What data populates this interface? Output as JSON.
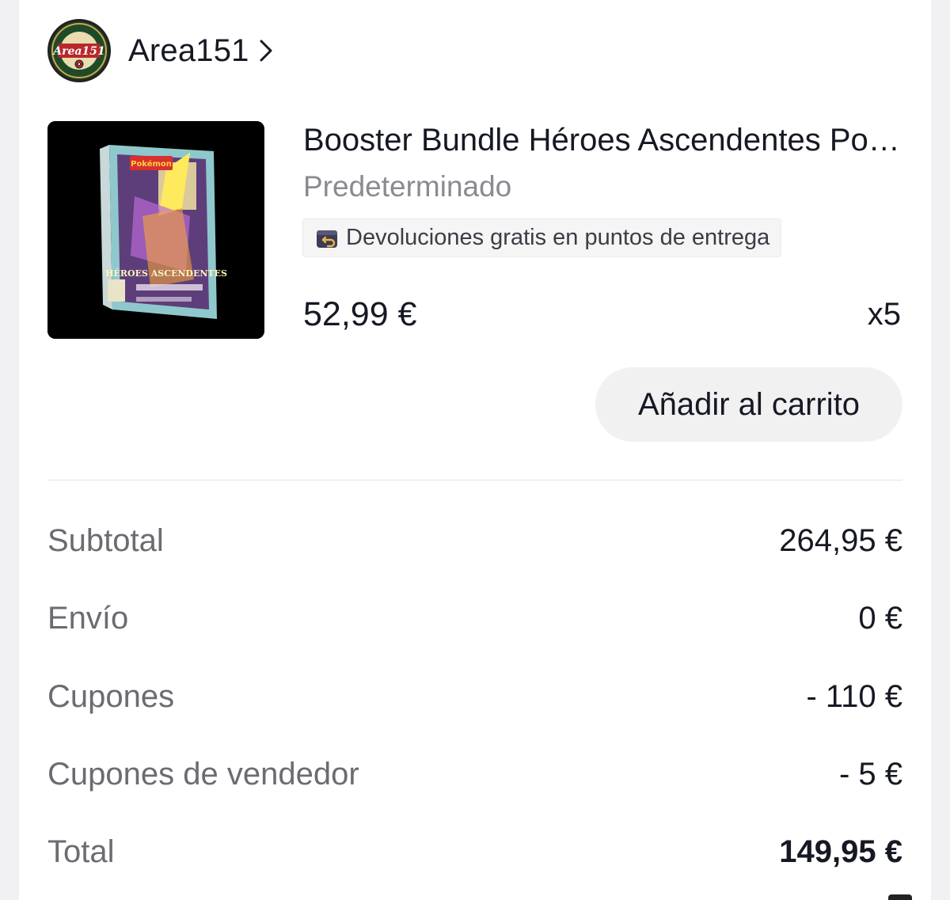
{
  "shop": {
    "name": "Area151",
    "logo_text": "Area151",
    "chevron_icon": "chevron-right-icon"
  },
  "product": {
    "title": "Booster Bundle Héroes Ascendentes Pokémon",
    "variant": "Predeterminado",
    "return_badge": "Devoluciones gratis en puntos de entrega",
    "return_icon": "return-arrow-icon",
    "price": "52,99 €",
    "quantity": "x5",
    "image_brand": "Pokémon",
    "image_title": "HÉROES ASCENDENTES"
  },
  "actions": {
    "add_to_cart": "Añadir al carrito"
  },
  "summary": {
    "rows": [
      {
        "label": "Subtotal",
        "value": "264,95 €"
      },
      {
        "label": "Envío",
        "value": "0 €"
      },
      {
        "label": "Cupones",
        "value": "- 110 €"
      },
      {
        "label": "Cupones de vendedor",
        "value": "- 5 €"
      },
      {
        "label": "Total",
        "value": "149,95 €"
      }
    ]
  },
  "colors": {
    "text_primary": "#161823",
    "text_secondary": "#8a8b91",
    "button_bg": "#f1f1f2",
    "page_bg": "#f1f1f3"
  }
}
